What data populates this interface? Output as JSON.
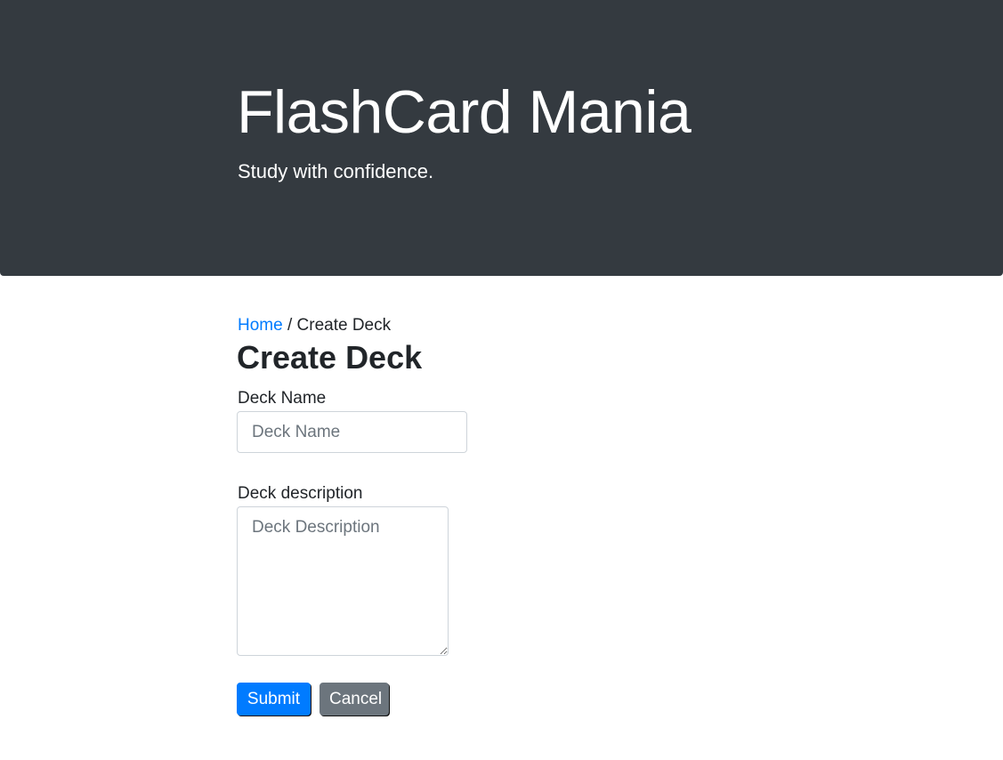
{
  "header": {
    "title": "FlashCard Mania",
    "subtitle": "Study with confidence."
  },
  "breadcrumb": {
    "home_label": "Home",
    "separator": "/",
    "current_label": "Create Deck"
  },
  "page": {
    "title": "Create Deck"
  },
  "form": {
    "name_label": "Deck Name",
    "name_placeholder": "Deck Name",
    "name_value": "",
    "description_label": "Deck description",
    "description_placeholder": "Deck Description",
    "description_value": "",
    "submit_label": "Submit",
    "cancel_label": "Cancel"
  },
  "colors": {
    "header_bg": "#343a40",
    "link": "#007bff",
    "primary": "#007bff",
    "secondary": "#6c757d"
  }
}
